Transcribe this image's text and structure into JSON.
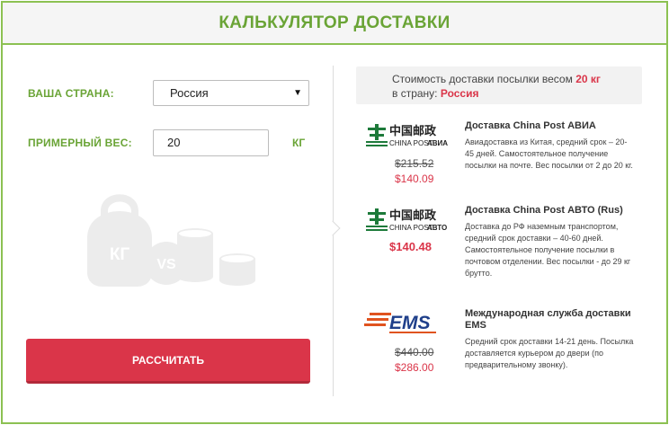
{
  "header": {
    "title": "КАЛЬКУЛЯТОР ДОСТАВКИ"
  },
  "form": {
    "country_label": "ВАША СТРАНА:",
    "country_value": "Россия",
    "weight_label": "ПРИМЕРНЫЙ ВЕС:",
    "weight_value": "20",
    "weight_unit": "КГ",
    "calculate_label": "РАССЧИТАТЬ",
    "illustration_text": {
      "kg": "КГ",
      "vs": "VS"
    }
  },
  "summary": {
    "prefix": "Стоимость доставки посылки весом",
    "weight": "20 кг",
    "country_prefix": "в страну:",
    "country": "Россия"
  },
  "offers": [
    {
      "logo_cn": "中国邮政",
      "logo_sub": "CHINA POST",
      "logo_badge": "АВИА",
      "title": "Доставка China Post АВИА",
      "description": "Авиадоставка из Китая, средний срок – 20-45 дней. Самостоятельное получение посылки на почте. Вес посылки от 2 до 20 кг.",
      "old_price": "$215.52",
      "price": "$140.09"
    },
    {
      "logo_cn": "中国邮政",
      "logo_sub": "CHINA POST",
      "logo_badge": "АВТО",
      "title": "Доставка China Post АВТО (Rus)",
      "description": "Доставка до РФ наземным транспортом, средний срок доставки – 40-60 дней. Самостоятельное получение посылки в почтовом отделении. Вес посылки - до 29 кг брутто.",
      "price": "$140.48"
    },
    {
      "logo_text": "EMS",
      "title": "Международная служба доставки EMS",
      "description": "Средний срок доставки 14-21 день. Посылка доставляется курьером до двери (по предварительному звонку).",
      "old_price": "$440.00",
      "price": "$286.00"
    }
  ],
  "colors": {
    "accent_green": "#6aa436",
    "border_green": "#8cc152",
    "button_red": "#da3549",
    "price_red": "#da3549"
  }
}
